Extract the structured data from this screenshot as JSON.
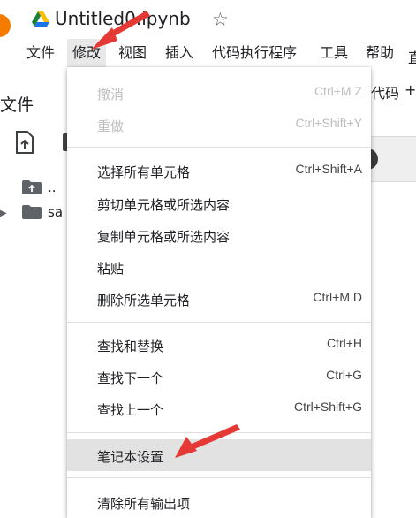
{
  "header": {
    "notebook_title": "Untitled0.ipynb",
    "star_icon": "star-outline-icon",
    "drive_icon": "google-drive-icon"
  },
  "menubar": {
    "items": [
      {
        "label": "文件"
      },
      {
        "label": "修改"
      },
      {
        "label": "视图"
      },
      {
        "label": "插入"
      },
      {
        "label": "代码执行程序"
      },
      {
        "label": "工具"
      },
      {
        "label": "帮助"
      }
    ]
  },
  "files_panel": {
    "title": "文件",
    "tree": [
      {
        "label": ".."
      },
      {
        "label": "sa"
      }
    ]
  },
  "background": {
    "code_label": "代码",
    "plus_label": "+",
    "right_char": "直"
  },
  "edit_menu": {
    "items": [
      {
        "label": "撤消",
        "shortcut": "Ctrl+M Z",
        "disabled": true
      },
      {
        "label": "重做",
        "shortcut": "Ctrl+Shift+Y",
        "disabled": true
      },
      {
        "label": "选择所有单元格",
        "shortcut": "Ctrl+Shift+A"
      },
      {
        "label": "剪切单元格或所选内容",
        "shortcut": ""
      },
      {
        "label": "复制单元格或所选内容",
        "shortcut": ""
      },
      {
        "label": "粘贴",
        "shortcut": ""
      },
      {
        "label": "删除所选单元格",
        "shortcut": "Ctrl+M D"
      },
      {
        "label": "查找和替换",
        "shortcut": "Ctrl+H"
      },
      {
        "label": "查找下一个",
        "shortcut": "Ctrl+G"
      },
      {
        "label": "查找上一个",
        "shortcut": "Ctrl+Shift+G"
      },
      {
        "label": "笔记本设置",
        "shortcut": "",
        "highlighted": true
      },
      {
        "label": "清除所有输出项",
        "shortcut": ""
      }
    ]
  },
  "colors": {
    "annotation_arrow": "#e53935",
    "highlight": "#e2e2e2",
    "disabled_text": "#bdbdbd"
  }
}
